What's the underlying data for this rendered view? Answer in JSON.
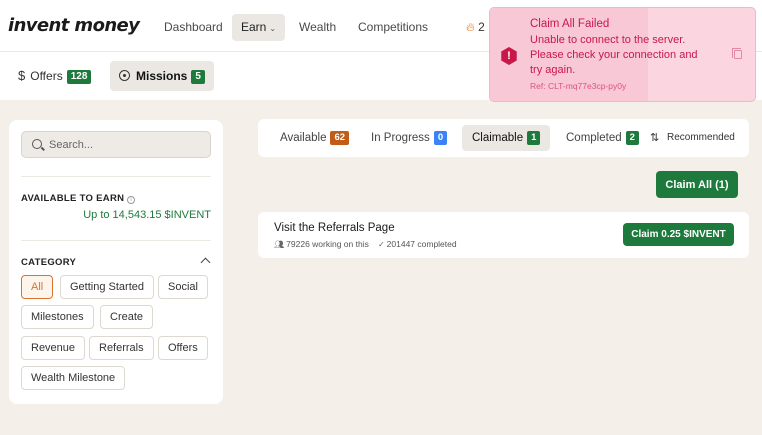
{
  "brand": {
    "logo_text": "invent money"
  },
  "nav": {
    "items": [
      {
        "label": "Dashboard"
      },
      {
        "label": "Earn"
      },
      {
        "label": "Wealth"
      },
      {
        "label": "Competitions"
      }
    ],
    "streak_count": "2"
  },
  "subnav": {
    "offers": {
      "label": "Offers",
      "count": "128"
    },
    "missions": {
      "label": "Missions",
      "count": "5"
    }
  },
  "sidebar": {
    "search_placeholder": "Search...",
    "available_label": "AVAILABLE TO EARN",
    "available_value": "Up to 14,543.15 $INVENT",
    "category_label": "CATEGORY",
    "categories": [
      "All",
      "Getting Started",
      "Social",
      "Milestones",
      "Create",
      "Revenue",
      "Referrals",
      "Offers",
      "Wealth Milestone"
    ],
    "selected_category": "All"
  },
  "tabs": {
    "items": [
      {
        "label": "Available",
        "count": "62",
        "color": "#c15d16"
      },
      {
        "label": "In Progress",
        "count": "0",
        "color": "#3b82f6"
      },
      {
        "label": "Claimable",
        "count": "1",
        "color": "#1e7a3c"
      },
      {
        "label": "Completed",
        "count": "2",
        "color": "#1e7a3c"
      }
    ],
    "sort_label": "Recommended"
  },
  "claim_all_label": "Claim All (1)",
  "mission": {
    "title": "Visit the Referrals Page",
    "working": "79226 working on this",
    "completed": "201447 completed",
    "claim_label": "Claim 0.25 $INVENT"
  },
  "toast": {
    "title": "Claim All Failed",
    "message": "Unable to connect to the server. Please check your connection and try again.",
    "ref": "Ref: CLT-mq77e3cp-py0y"
  },
  "colors": {
    "accent_green": "#1e7a3c",
    "accent_orange": "#d9732d",
    "error": "#c8184a"
  }
}
